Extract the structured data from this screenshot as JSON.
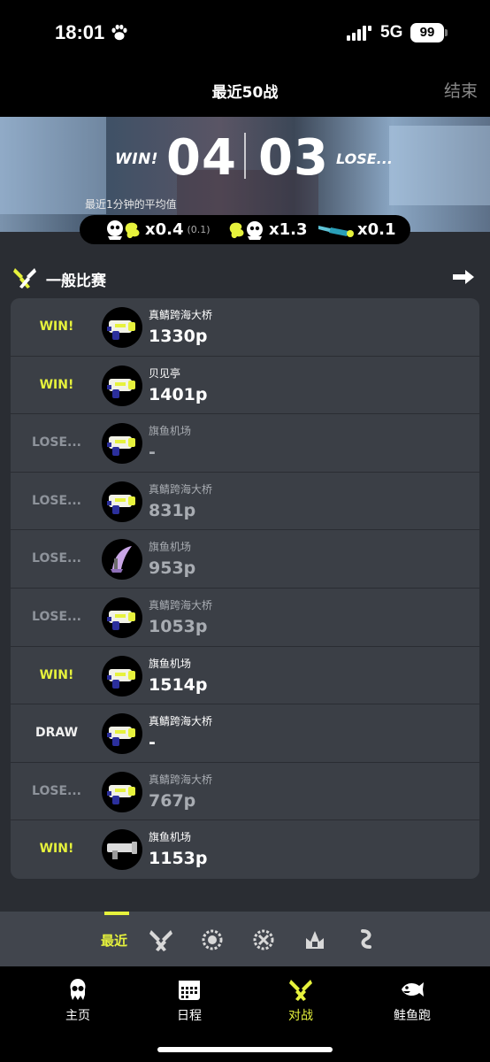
{
  "status_bar": {
    "time": "18:01",
    "network": "5G",
    "battery": "99"
  },
  "header": {
    "title": "最近50战",
    "end_label": "结束"
  },
  "summary": {
    "win_label": "WIN!",
    "wins": "04",
    "losses": "03",
    "lose_label": "LOSE...",
    "avg_caption": "最近1分钟的平均值",
    "stats": [
      {
        "icon": "splat-kill-icon",
        "value": "x0.4",
        "sub": "(0.1)"
      },
      {
        "icon": "splat-death-icon",
        "value": "x1.3"
      },
      {
        "icon": "special-weapon-icon",
        "value": "x0.1"
      }
    ]
  },
  "section": {
    "icon": "battle-crossed-icon",
    "title": "一般比赛",
    "arrow_icon": "arrow-right-icon"
  },
  "matches": [
    {
      "result": "WIN!",
      "type": "win",
      "weapon_icon": "blaster-weapon-icon",
      "stage": "真鲭跨海大桥",
      "power": "1330p"
    },
    {
      "result": "WIN!",
      "type": "win",
      "weapon_icon": "blaster-weapon-icon",
      "stage": "贝见亭",
      "power": "1401p"
    },
    {
      "result": "LOSE...",
      "type": "lose",
      "weapon_icon": "blaster-weapon-icon",
      "stage": "旗鱼机场",
      "power": "-"
    },
    {
      "result": "LOSE...",
      "type": "lose",
      "weapon_icon": "blaster-weapon-icon",
      "stage": "真鲭跨海大桥",
      "power": "831p"
    },
    {
      "result": "LOSE...",
      "type": "lose",
      "weapon_icon": "splatana-weapon-icon",
      "stage": "旗鱼机场",
      "power": "953p"
    },
    {
      "result": "LOSE...",
      "type": "lose",
      "weapon_icon": "blaster-weapon-icon",
      "stage": "真鲭跨海大桥",
      "power": "1053p"
    },
    {
      "result": "WIN!",
      "type": "win",
      "weapon_icon": "blaster-weapon-icon",
      "stage": "旗鱼机场",
      "power": "1514p"
    },
    {
      "result": "DRAW",
      "type": "draw",
      "weapon_icon": "blaster-weapon-icon",
      "stage": "真鲭跨海大桥",
      "power": "-"
    },
    {
      "result": "LOSE...",
      "type": "lose",
      "weapon_icon": "blaster-weapon-icon",
      "stage": "真鲭跨海大桥",
      "power": "767p"
    },
    {
      "result": "WIN!",
      "type": "win",
      "weapon_icon": "launcher-weapon-icon",
      "stage": "旗鱼机场",
      "power": "1153p"
    }
  ],
  "filter_bar": {
    "recent_label": "最近",
    "icons": [
      "regular-battle-icon",
      "anarchy-battle-icon",
      "x-battle-icon",
      "challenge-icon",
      "private-battle-icon"
    ]
  },
  "nav": {
    "items": [
      {
        "icon": "squid-home-icon",
        "label": "主页"
      },
      {
        "icon": "calendar-icon",
        "label": "日程"
      },
      {
        "icon": "battle-icon",
        "label": "对战"
      },
      {
        "icon": "salmon-icon",
        "label": "鲑鱼跑"
      }
    ]
  },
  "colors": {
    "accent": "#e6f23c",
    "row_bg": "#3b3f46",
    "page_bg": "#2a2d33"
  }
}
